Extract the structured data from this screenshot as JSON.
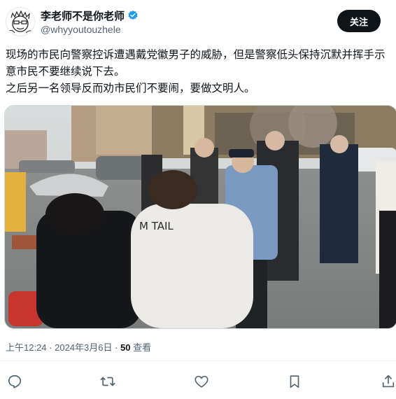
{
  "user": {
    "display_name": "李老师不是你老师",
    "handle": "@whyyoutouzhele",
    "verified_icon": "verified-badge-icon",
    "avatar_icon": "cartoon-face-avatar"
  },
  "follow_label": "关注",
  "tweet": {
    "line1": "现场的市民向警察控诉遭遇戴党徽男子的威胁，但是警察低头保持沉默并挥手示意市民不要继续说下去。",
    "line2": "之后另一名领导反而劝市民们不要闹，要做文明人。"
  },
  "media": {
    "jacket_text": "M TAIL"
  },
  "meta": {
    "time": "上午12:24",
    "separator1": " · ",
    "date": "2024年3月6日",
    "separator2": " · ",
    "views_count": "50",
    "views_label": " 查看"
  },
  "actions": [
    "reply-icon",
    "retweet-icon",
    "like-icon",
    "bookmark-icon",
    "share-icon"
  ],
  "colors": {
    "text": "#0f1419",
    "secondary": "#536471",
    "verified": "#1d9bf0",
    "follow_bg": "#0f1419"
  }
}
